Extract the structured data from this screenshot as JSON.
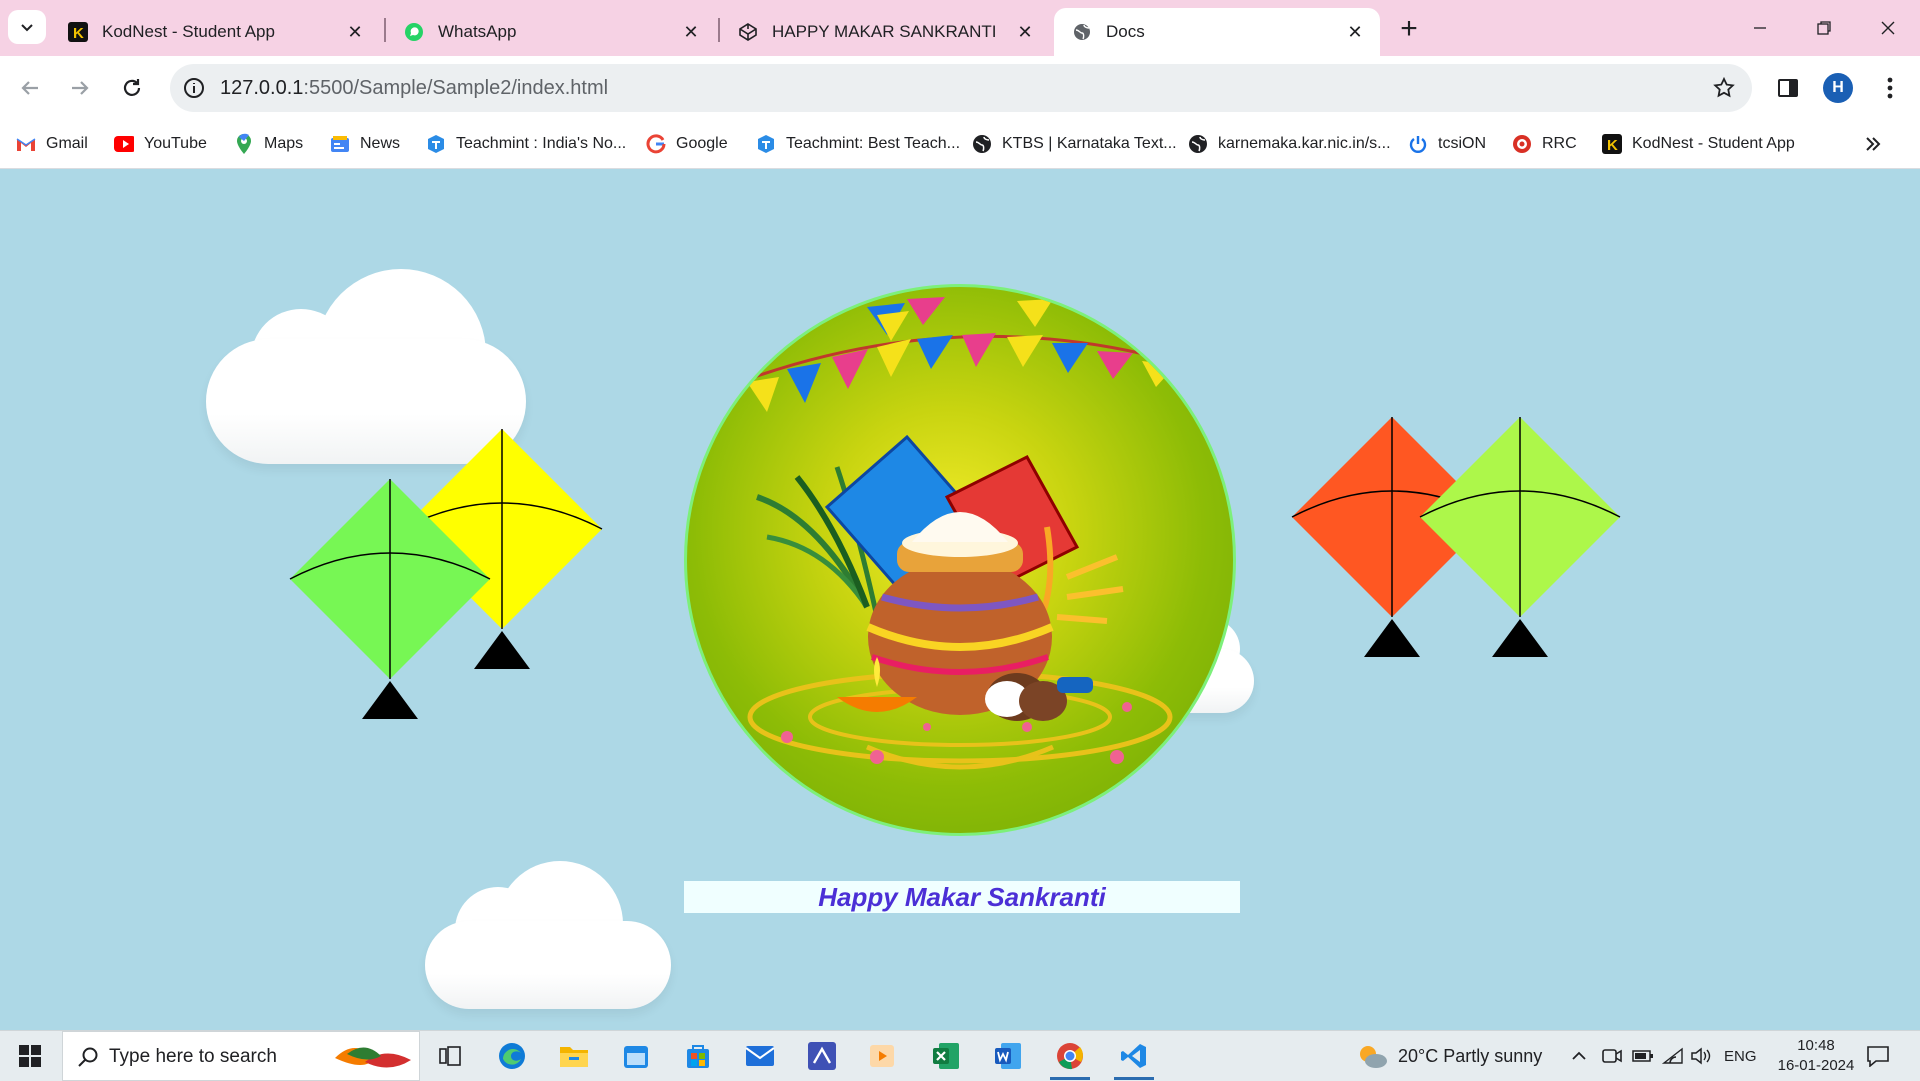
{
  "browser": {
    "tabs": [
      {
        "title": "KodNest - Student App",
        "icon": "kodnest-icon"
      },
      {
        "title": "WhatsApp",
        "icon": "whatsapp-icon"
      },
      {
        "title": "HAPPY MAKAR SANKRANTI",
        "icon": "codepen-icon"
      },
      {
        "title": "Docs",
        "icon": "globe-icon"
      }
    ],
    "address": {
      "host": "127.0.0.1",
      "path": ":5500/Sample/Sample2/index.html"
    },
    "profile_initial": "H",
    "bookmarks": [
      {
        "label": "Gmail",
        "icon": "gmail-icon"
      },
      {
        "label": "YouTube",
        "icon": "youtube-icon"
      },
      {
        "label": "Maps",
        "icon": "maps-icon"
      },
      {
        "label": "News",
        "icon": "news-icon"
      },
      {
        "label": "Teachmint : India's No...",
        "icon": "teachmint-icon"
      },
      {
        "label": "Google",
        "icon": "google-icon"
      },
      {
        "label": "Teachmint: Best Teach...",
        "icon": "teachmint-icon"
      },
      {
        "label": "KTBS | Karnataka Text...",
        "icon": "globe-icon"
      },
      {
        "label": "karnemaka.kar.nic.in/s...",
        "icon": "globe-icon"
      },
      {
        "label": "tcsiON",
        "icon": "tcsion-icon"
      },
      {
        "label": "RRC",
        "icon": "rrc-icon"
      },
      {
        "label": "KodNest - Student App",
        "icon": "kodnest-icon"
      }
    ]
  },
  "page": {
    "greeting": "Happy Makar Sankranti",
    "colors": {
      "background": "#add8e6",
      "greeting_text": "#4b2fd6",
      "greeting_bg": "#f0ffff"
    },
    "kites": [
      {
        "color": "#77f754"
      },
      {
        "color": "#ffff00"
      },
      {
        "color": "#ff5722"
      },
      {
        "color": "#adf74a"
      }
    ]
  },
  "taskbar": {
    "search_placeholder": "Type here to search",
    "weather": "20°C  Partly sunny",
    "language": "ENG",
    "time": "10:48",
    "date": "16-01-2024"
  }
}
